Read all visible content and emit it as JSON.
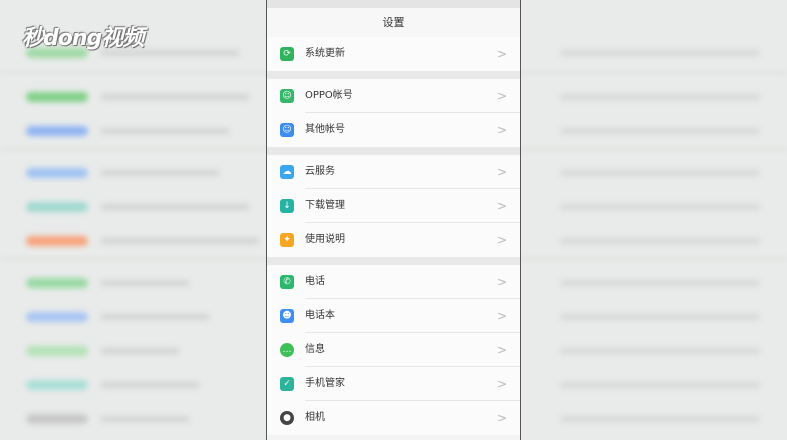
{
  "watermark": {
    "text": "秒dong视频"
  },
  "header": {
    "title": "设置"
  },
  "groups": [
    {
      "items": [
        {
          "label": "系统更新",
          "icon": "system-update-icon",
          "color": "#2fb35c"
        }
      ]
    },
    {
      "items": [
        {
          "label": "OPPO帐号",
          "icon": "oppo-account-icon",
          "color": "#35b86a"
        },
        {
          "label": "其他帐号",
          "icon": "other-account-icon",
          "color": "#3d8df0"
        }
      ]
    },
    {
      "items": [
        {
          "label": "云服务",
          "icon": "cloud-icon",
          "color": "#3aa6ee"
        },
        {
          "label": "下载管理",
          "icon": "download-icon",
          "color": "#26b3a3"
        },
        {
          "label": "使用说明",
          "icon": "lightbulb-icon",
          "color": "#f5a623"
        }
      ]
    },
    {
      "items": [
        {
          "label": "电话",
          "icon": "phone-icon",
          "color": "#2bb76c"
        },
        {
          "label": "电话本",
          "icon": "contacts-icon",
          "color": "#3f8ff2"
        },
        {
          "label": "信息",
          "icon": "message-icon",
          "color": "#3fbf58"
        },
        {
          "label": "手机管家",
          "icon": "phone-manager-icon",
          "color": "#2cb39a"
        },
        {
          "label": "相机",
          "icon": "camera-icon",
          "color": "#444444"
        }
      ]
    }
  ]
}
